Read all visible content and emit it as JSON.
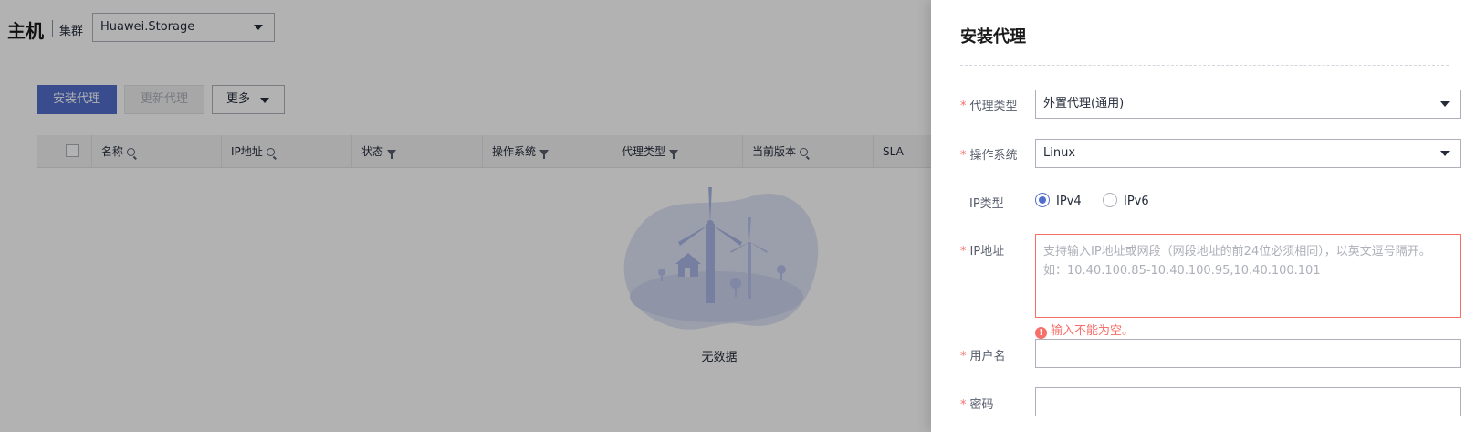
{
  "header": {
    "title": "主机",
    "cluster_label": "集群",
    "cluster_value": "Huawei.Storage"
  },
  "toolbar": {
    "install_label": "安装代理",
    "update_label": "更新代理",
    "more_label": "更多"
  },
  "table": {
    "columns": [
      "名称",
      "IP地址",
      "状态",
      "操作系统",
      "代理类型",
      "当前版本",
      "SLA"
    ],
    "empty_text": "无数据"
  },
  "drawer": {
    "title": "安装代理",
    "agent_type": {
      "label": "代理类型",
      "value": "外置代理(通用)"
    },
    "os": {
      "label": "操作系统",
      "value": "Linux"
    },
    "ip_type": {
      "label": "IP类型",
      "options": [
        "IPv4",
        "IPv6"
      ],
      "selected": "IPv4"
    },
    "ip_address": {
      "label": "IP地址",
      "placeholder": "支持输入IP地址或网段（网段地址的前24位必须相同），以英文逗号隔开。如：10.40.100.85-10.40.100.95,10.40.100.101",
      "error": "输入不能为空。"
    },
    "username": {
      "label": "用户名",
      "value": ""
    },
    "password": {
      "label": "密码",
      "value": ""
    }
  },
  "colors": {
    "primary": "#526ecc",
    "error": "#f66f6a",
    "overlay": "rgba(0,0,0,0.30)"
  }
}
